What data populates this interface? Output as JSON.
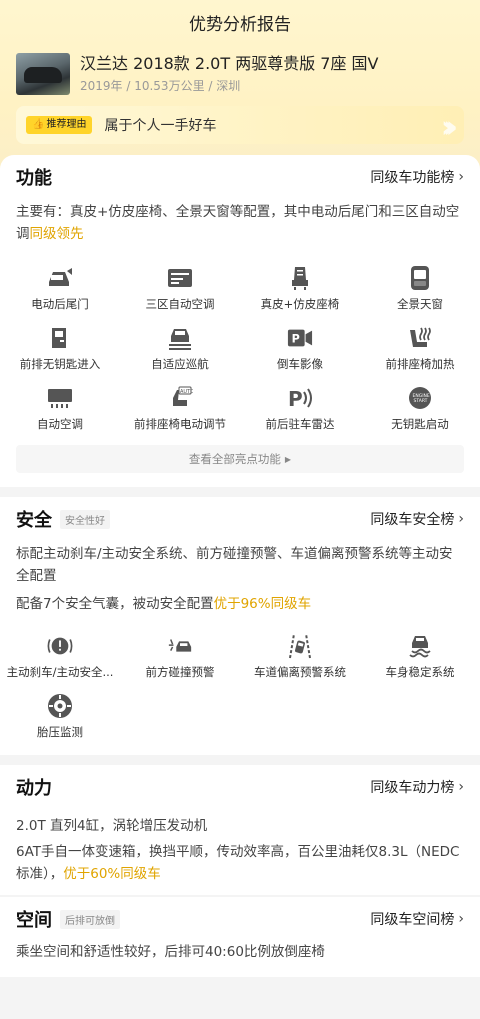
{
  "header": {
    "title": "优势分析报告"
  },
  "car": {
    "title": "汉兰达 2018款 2.0T 两驱尊贵版 7座 国V",
    "meta": "2019年 / 10.53万公里 / 深圳"
  },
  "reason": {
    "tag": "推荐理由",
    "text": "属于个人一手好车"
  },
  "function": {
    "title": "功能",
    "rank": "同级车功能榜",
    "desc_prefix": "主要有：真皮+仿皮座椅、全景天窗等配置，其中电动后尾门和三区自动空调",
    "desc_highlight": "同级领先",
    "items": [
      {
        "label": "电动后尾门",
        "icon": "tailgate-icon"
      },
      {
        "label": "三区自动空调",
        "icon": "climate-icon"
      },
      {
        "label": "真皮+仿皮座椅",
        "icon": "seat-icon"
      },
      {
        "label": "全景天窗",
        "icon": "sunroof-icon"
      },
      {
        "label": "前排无钥匙进入",
        "icon": "door-key-icon"
      },
      {
        "label": "自适应巡航",
        "icon": "cruise-icon"
      },
      {
        "label": "倒车影像",
        "icon": "camera-icon"
      },
      {
        "label": "前排座椅加热",
        "icon": "seat-heat-icon"
      },
      {
        "label": "自动空调",
        "icon": "ac-icon"
      },
      {
        "label": "前排座椅电动调节",
        "icon": "seat-adjust-icon"
      },
      {
        "label": "前后驻车雷达",
        "icon": "parking-radar-icon"
      },
      {
        "label": "无钥匙启动",
        "icon": "start-button-icon"
      }
    ],
    "more": "查看全部亮点功能"
  },
  "safety": {
    "title": "安全",
    "tag": "安全性好",
    "rank": "同级车安全榜",
    "desc1": "标配主动刹车/主动安全系统、前方碰撞预警、车道偏离预警系统等主动安全配置",
    "desc2_prefix": "配备7个安全气囊，被动安全配置",
    "desc2_highlight": "优于96%同级车",
    "items": [
      {
        "label": "主动刹车/主动安全...",
        "icon": "brake-icon"
      },
      {
        "label": "前方碰撞预警",
        "icon": "collision-icon"
      },
      {
        "label": "车道偏离预警系统",
        "icon": "lane-icon"
      },
      {
        "label": "车身稳定系统",
        "icon": "stability-icon"
      },
      {
        "label": "胎压监测",
        "icon": "tire-pressure-icon"
      }
    ]
  },
  "power": {
    "title": "动力",
    "rank": "同级车动力榜",
    "line1": "2.0T 直列4缸，涡轮增压发动机",
    "line2_prefix": "6AT手自一体变速箱，换挡平顺，传动效率高，百公里油耗仅8.3L（NEDC标准），",
    "line2_highlight": "优于60%同级车"
  },
  "space": {
    "title": "空间",
    "tag": "后排可放倒",
    "rank": "同级车空间榜",
    "line1": "乘坐空间和舒适性较好，后排可40:60比例放倒座椅"
  },
  "colors": {
    "highlight": "#e0a400",
    "tag_yellow": "#ffd42a",
    "bg": "#f4f4f4"
  }
}
